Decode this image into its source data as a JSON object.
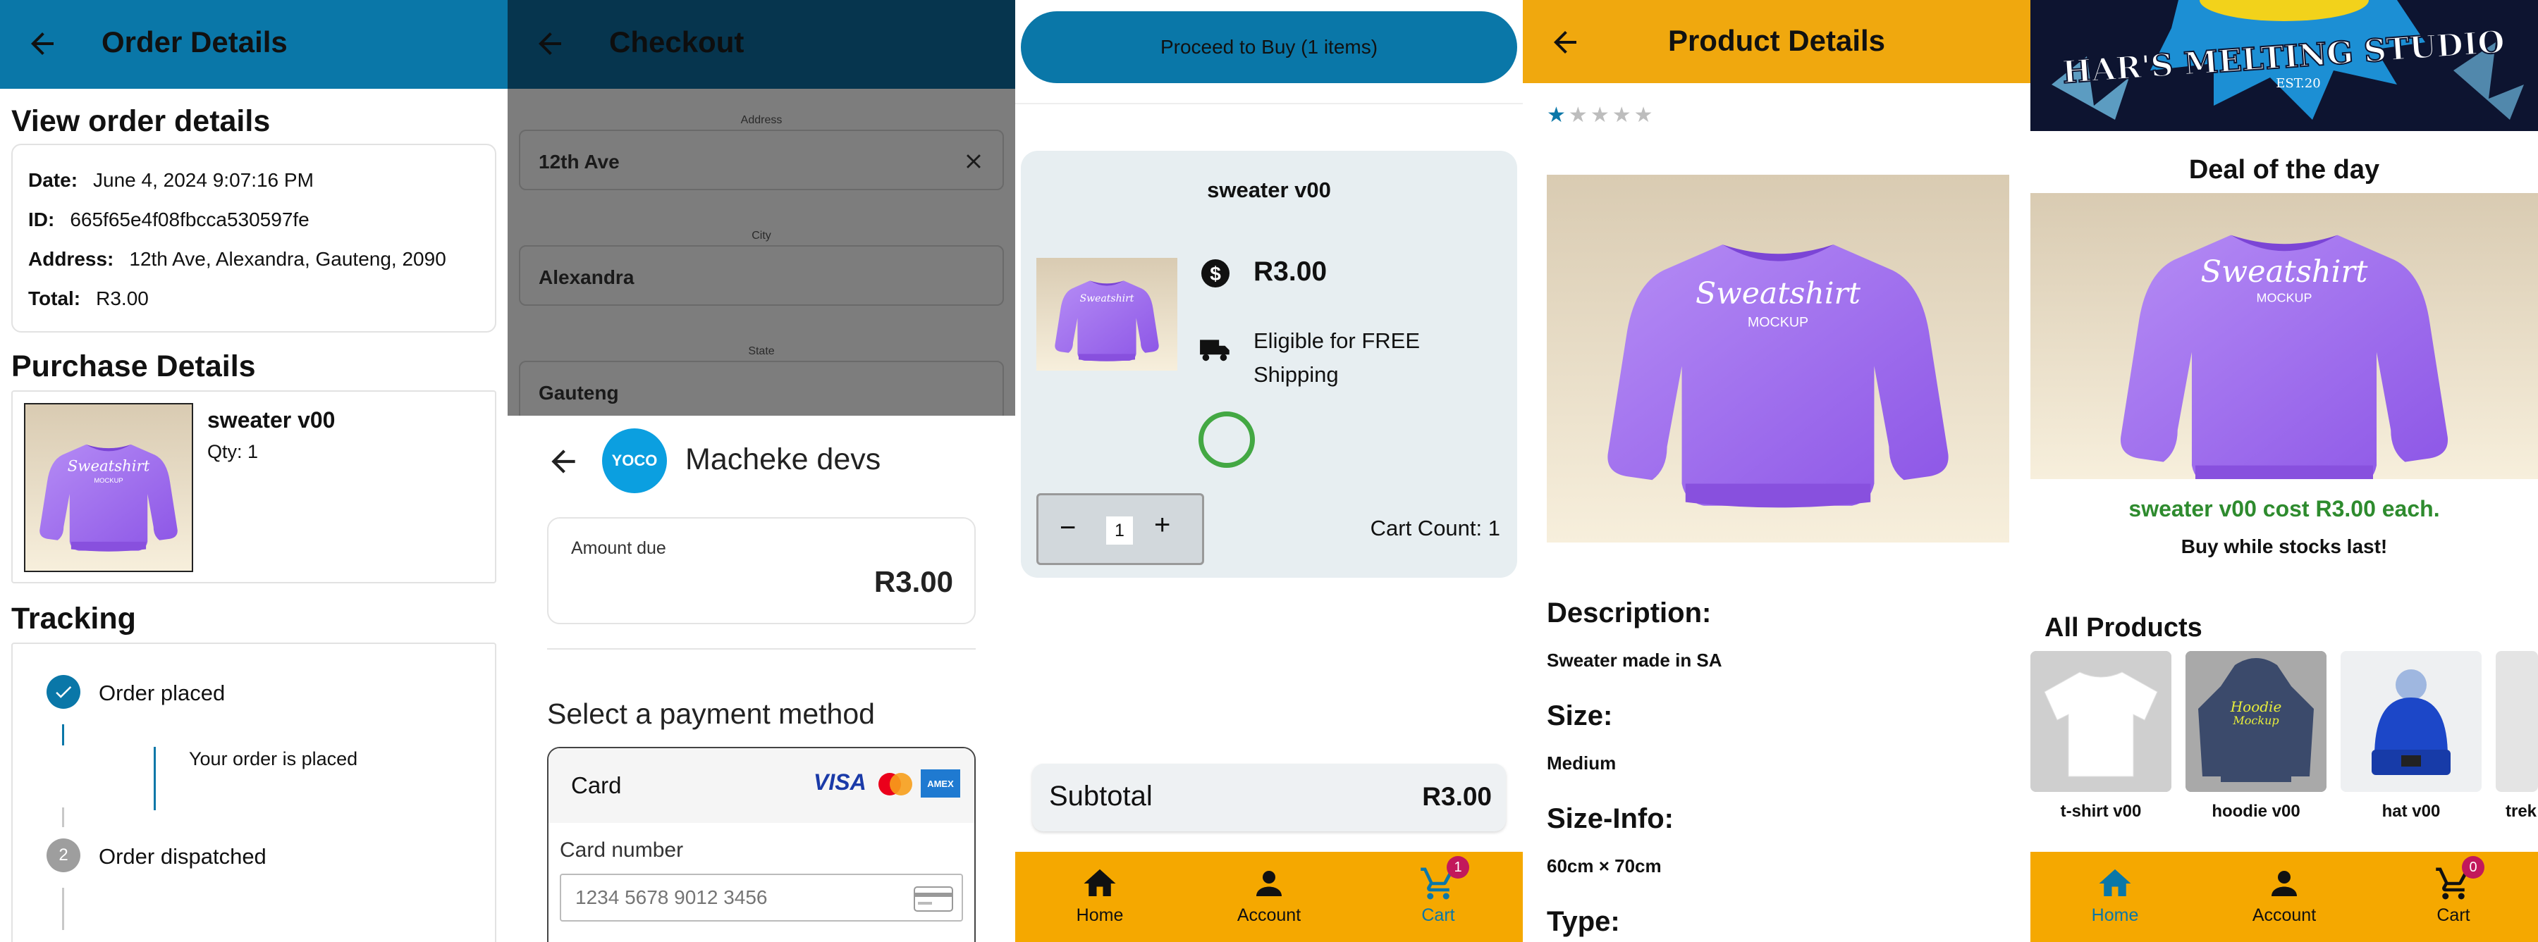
{
  "order": {
    "title": "Order Details",
    "view_heading": "View order details",
    "date_label": "Date:",
    "date_value": "June 4, 2024 9:07:16 PM",
    "id_label": "ID:",
    "id_value": "665f65e4f08fbcca530597fe",
    "address_label": "Address:",
    "address_value": "12th Ave, Alexandra, Gauteng, 2090",
    "total_label": "Total:",
    "total_value": "R3.00",
    "purchase_heading": "Purchase Details",
    "item_name": "sweater v00",
    "item_qty": "Qty: 1",
    "tracking_heading": "Tracking",
    "step1": "Order placed",
    "step1_sub": "Your order is placed",
    "step2_num": "2",
    "step2": "Order dispatched"
  },
  "checkout": {
    "title": "Checkout",
    "address_label": "Address",
    "address_value": "12th Ave",
    "city_label": "City",
    "city_value": "Alexandra",
    "state_label": "State",
    "state_value": "Gauteng",
    "merchant_logo": "YOCO",
    "merchant": "Macheke devs",
    "amount_due_label": "Amount due",
    "amount_due_value": "R3.00",
    "payment_heading": "Select a payment method",
    "card_label": "Card",
    "card_brands": [
      "VISA",
      "AMEX"
    ],
    "card_number_label": "Card number",
    "card_number_placeholder": "1234 5678 9012 3456"
  },
  "cart": {
    "proceed_label": "Proceed to Buy (1 items)",
    "item_name": "sweater v00",
    "price": "R3.00",
    "shipping_line1": "Eligible for FREE",
    "shipping_line2": "Shipping",
    "qty": "1",
    "minus": "−",
    "plus": "+",
    "cart_count": "Cart Count: 1",
    "subtotal_label": "Subtotal",
    "subtotal_value": "R3.00",
    "nav": [
      {
        "label": "Home",
        "icon": "home-icon"
      },
      {
        "label": "Account",
        "icon": "account-icon"
      },
      {
        "label": "Cart",
        "icon": "cart-icon",
        "badge": "1"
      }
    ]
  },
  "product": {
    "title": "Product Details",
    "rating": 1,
    "rating_max": 5,
    "description_label": "Description:",
    "description_value": "Sweater made in SA",
    "size_label": "Size:",
    "size_value": "Medium",
    "size_info_label": "Size-Info:",
    "size_info_value": "60cm × 70cm",
    "type_label": "Type:"
  },
  "home": {
    "banner_text": "HAR'S MELTING STUDIO",
    "banner_est": "EST.20",
    "deal_heading": "Deal of the day",
    "deal_text": "sweater v00 cost R3.00 each.",
    "deal_sub": "Buy while stocks last!",
    "all_products_heading": "All Products",
    "products": [
      "t-shirt v00",
      "hoodie v00",
      "hat v00",
      "trek"
    ],
    "nav": [
      {
        "label": "Home",
        "icon": "home-icon"
      },
      {
        "label": "Account",
        "icon": "account-icon"
      },
      {
        "label": "Cart",
        "icon": "cart-icon",
        "badge": "0"
      }
    ]
  },
  "mockup_text": {
    "line1": "Sweatshirt",
    "line2": "MOCKUP",
    "hoodie1": "Hoodie",
    "hoodie2": "Mockup"
  },
  "colors": {
    "blue_bar": "#0a77a8",
    "dark_bar": "#06354e",
    "amber": "#f5a800",
    "deal_green": "#2e8b2e",
    "badge": "#c2185b"
  }
}
